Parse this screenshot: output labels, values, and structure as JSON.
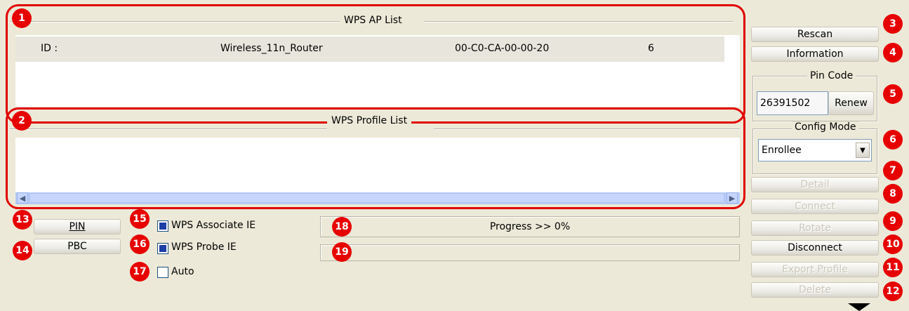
{
  "ap_list": {
    "title": "WPS AP List",
    "row": {
      "id_label": "ID :",
      "ssid": "Wireless_11n_Router",
      "mac": "00-C0-CA-00-00-20",
      "channel": "6"
    }
  },
  "profile_list": {
    "title": "WPS Profile List"
  },
  "right_panel": {
    "rescan": "Rescan",
    "information": "Information",
    "pin_code_title": "Pin Code",
    "pin_value": "26391502",
    "renew": "Renew",
    "config_mode_title": "Config Mode",
    "config_mode_value": "Enrollee",
    "detail": "Detail",
    "connect": "Connect",
    "rotate": "Rotate",
    "disconnect": "Disconnect",
    "export_profile": "Export Profile",
    "delete": "Delete"
  },
  "bottom": {
    "pin_button": "PIN",
    "pbc_button": "PBC",
    "wps_associate_ie": "WPS Associate IE",
    "wps_probe_ie": "WPS Probe IE",
    "auto": "Auto",
    "progress_text": "Progress >> 0%",
    "wps_associate_checked": true,
    "wps_probe_checked": true,
    "auto_checked": false
  },
  "badges": [
    "1",
    "2",
    "3",
    "4",
    "5",
    "6",
    "7",
    "8",
    "9",
    "10",
    "11",
    "12",
    "13",
    "14",
    "15",
    "16",
    "17",
    "18",
    "19"
  ],
  "colors": {
    "annotation_red": "#e00000",
    "window_bg": "#ece9d8",
    "selection": "#e8e6dc"
  }
}
